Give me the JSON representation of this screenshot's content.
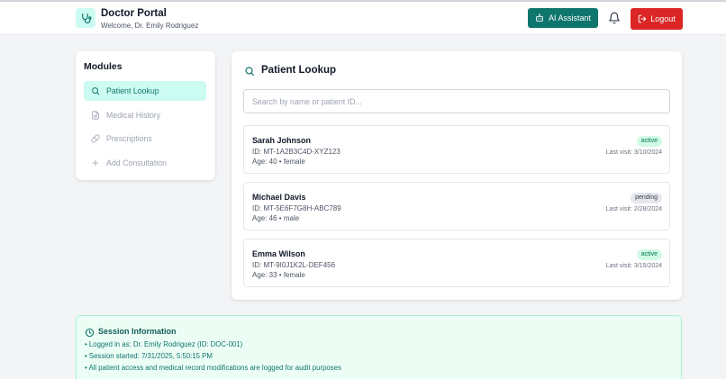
{
  "header": {
    "title": "Doctor Portal",
    "subtitle": "Welcome, Dr. Emily Rodriguez",
    "ai_button": "AI Assistant",
    "logout_button": "Logout"
  },
  "modules": {
    "title": "Modules",
    "items": [
      {
        "label": "Patient Lookup",
        "icon": "search-icon",
        "active": true
      },
      {
        "label": "Medical History",
        "icon": "document-icon",
        "active": false
      },
      {
        "label": "Prescriptions",
        "icon": "pill-icon",
        "active": false
      },
      {
        "label": "Add Consultation",
        "icon": "plus-icon",
        "active": false
      }
    ]
  },
  "lookup": {
    "title": "Patient Lookup",
    "search_placeholder": "Search by name or patient ID...",
    "patients": [
      {
        "name": "Sarah Johnson",
        "id": "ID: MT-1A2B3C4D-XYZ123",
        "meta": "Age: 40 • female",
        "status": "active",
        "last_visit": "Last visit: 3/10/2024"
      },
      {
        "name": "Michael Davis",
        "id": "ID: MT-5E6F7G8H-ABC789",
        "meta": "Age: 46 • male",
        "status": "pending",
        "last_visit": "Last visit: 2/28/2024"
      },
      {
        "name": "Emma Wilson",
        "id": "ID: MT-9I0J1K2L-DEF456",
        "meta": "Age: 33 • female",
        "status": "active",
        "last_visit": "Last visit: 3/15/2024"
      }
    ]
  },
  "session": {
    "title": "Session Information",
    "lines": [
      "• Logged in as: Dr. Emily Rodriguez (ID: DOC-001)",
      "• Session started: 7/31/2025, 5:50:15 PM",
      "• All patient access and medical record modifications are logged for audit purposes"
    ]
  },
  "colors": {
    "accent": "#0f766e",
    "accent_light": "#ccfbf1",
    "danger": "#dc2626",
    "page_bg": "#f3f4f6"
  }
}
